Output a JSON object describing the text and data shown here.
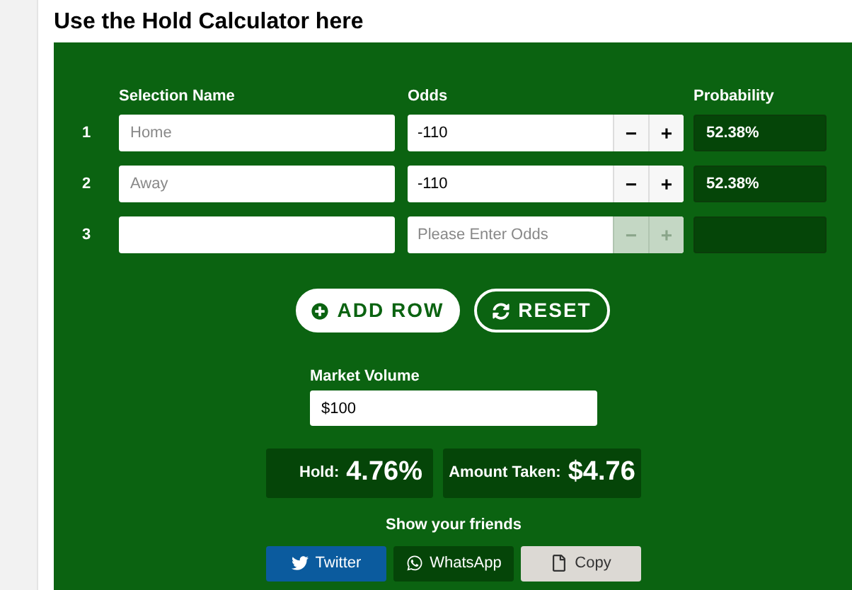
{
  "title": "Use the Hold Calculator here",
  "columns": [
    "Selection Name",
    "Odds",
    "Probability"
  ],
  "rows": [
    {
      "number": "1",
      "name_placeholder": "Home",
      "odds_value": "-110",
      "probability": "52.38%",
      "buttons_disabled": false,
      "minus": "−",
      "plus": "+"
    },
    {
      "number": "2",
      "name_placeholder": "Away",
      "odds_value": "-110",
      "probability": "52.38%",
      "buttons_disabled": false,
      "minus": "−",
      "plus": "+"
    },
    {
      "number": "3",
      "odds_placeholder": "Please Enter Odds",
      "buttons_disabled": true,
      "minus": "−",
      "plus": "+"
    }
  ],
  "actions": [
    {
      "label": "ADD ROW",
      "kind": "add"
    },
    {
      "label": "RESET",
      "kind": "reset"
    }
  ],
  "market_volume": {
    "label": "Market Volume",
    "value": "$100"
  },
  "results": [
    {
      "label": "Hold:",
      "value": "4.76%"
    },
    {
      "label": "Amount Taken:",
      "value": "$4.76"
    }
  ],
  "share": {
    "label": "Show your friends",
    "buttons": [
      {
        "label": "Twitter",
        "kind": "twitter"
      },
      {
        "label": "WhatsApp",
        "kind": "whatsapp"
      },
      {
        "label": "Copy",
        "kind": "copy"
      }
    ]
  }
}
